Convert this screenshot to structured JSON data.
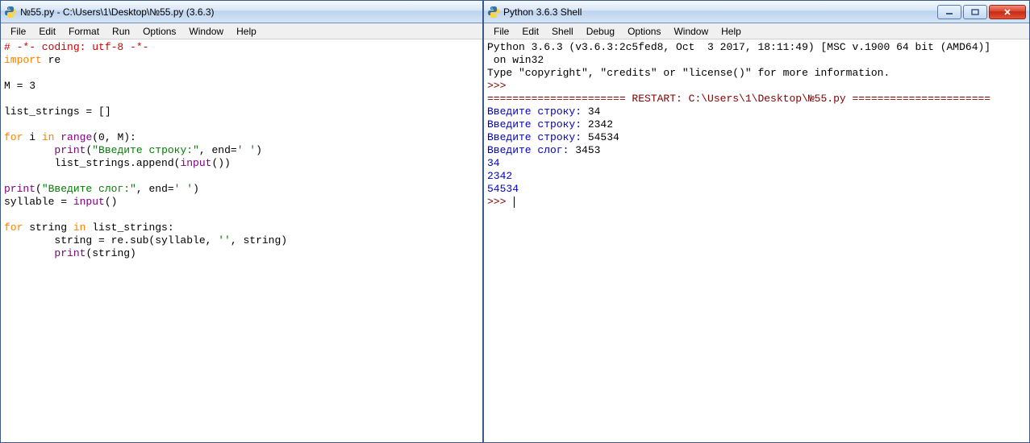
{
  "editor": {
    "title": "№55.py - C:\\Users\\1\\Desktop\\№55.py (3.6.3)",
    "menu": [
      "File",
      "Edit",
      "Format",
      "Run",
      "Options",
      "Window",
      "Help"
    ],
    "code": [
      {
        "cls": "c-comment",
        "text": "# -*- coding: utf-8 -*-"
      },
      [
        {
          "cls": "c-keyword",
          "text": "import"
        },
        {
          "cls": "c-normal",
          "text": " re"
        }
      ],
      "",
      [
        {
          "cls": "c-normal",
          "text": "M = 3"
        }
      ],
      "",
      [
        {
          "cls": "c-normal",
          "text": "list_strings = []"
        }
      ],
      "",
      [
        {
          "cls": "c-keyword",
          "text": "for"
        },
        {
          "cls": "c-normal",
          "text": " i "
        },
        {
          "cls": "c-keyword",
          "text": "in"
        },
        {
          "cls": "c-normal",
          "text": " "
        },
        {
          "cls": "c-builtin",
          "text": "range"
        },
        {
          "cls": "c-normal",
          "text": "(0, M):"
        }
      ],
      [
        {
          "cls": "c-normal",
          "text": "        "
        },
        {
          "cls": "c-builtin",
          "text": "print"
        },
        {
          "cls": "c-normal",
          "text": "("
        },
        {
          "cls": "c-string",
          "text": "\"Введите строку:\""
        },
        {
          "cls": "c-normal",
          "text": ", end="
        },
        {
          "cls": "c-string",
          "text": "' '"
        },
        {
          "cls": "c-normal",
          "text": ")"
        }
      ],
      [
        {
          "cls": "c-normal",
          "text": "        list_strings.append("
        },
        {
          "cls": "c-builtin",
          "text": "input"
        },
        {
          "cls": "c-normal",
          "text": "())"
        }
      ],
      "",
      [
        {
          "cls": "c-builtin",
          "text": "print"
        },
        {
          "cls": "c-normal",
          "text": "("
        },
        {
          "cls": "c-string",
          "text": "\"Введите слог:\""
        },
        {
          "cls": "c-normal",
          "text": ", end="
        },
        {
          "cls": "c-string",
          "text": "' '"
        },
        {
          "cls": "c-normal",
          "text": ")"
        }
      ],
      [
        {
          "cls": "c-normal",
          "text": "syllable = "
        },
        {
          "cls": "c-builtin",
          "text": "input"
        },
        {
          "cls": "c-normal",
          "text": "()"
        }
      ],
      "",
      [
        {
          "cls": "c-keyword",
          "text": "for"
        },
        {
          "cls": "c-normal",
          "text": " string "
        },
        {
          "cls": "c-keyword",
          "text": "in"
        },
        {
          "cls": "c-normal",
          "text": " list_strings:"
        }
      ],
      [
        {
          "cls": "c-normal",
          "text": "        string = re.sub(syllable, "
        },
        {
          "cls": "c-string",
          "text": "''"
        },
        {
          "cls": "c-normal",
          "text": ", string)"
        }
      ],
      [
        {
          "cls": "c-normal",
          "text": "        "
        },
        {
          "cls": "c-builtin",
          "text": "print"
        },
        {
          "cls": "c-normal",
          "text": "(string)"
        }
      ]
    ]
  },
  "shell": {
    "title": "Python 3.6.3 Shell",
    "menu": [
      "File",
      "Edit",
      "Shell",
      "Debug",
      "Options",
      "Window",
      "Help"
    ],
    "lines": [
      [
        {
          "cls": "c-normal",
          "text": "Python 3.6.3 (v3.6.3:2c5fed8, Oct  3 2017, 18:11:49) [MSC v.1900 64 bit (AMD64)]"
        }
      ],
      [
        {
          "cls": "c-normal",
          "text": " on win32"
        }
      ],
      [
        {
          "cls": "c-normal",
          "text": "Type \"copyright\", \"credits\" or \"license()\" for more information."
        }
      ],
      [
        {
          "cls": "c-prompt",
          "text": ">>> "
        }
      ],
      [
        {
          "cls": "c-prompt",
          "text": "====================== RESTART: C:\\Users\\1\\Desktop\\№55.py ======================"
        }
      ],
      [
        {
          "cls": "c-blue",
          "text": "Введите строку:"
        },
        {
          "cls": "c-normal",
          "text": " 34"
        }
      ],
      [
        {
          "cls": "c-blue",
          "text": "Введите строку:"
        },
        {
          "cls": "c-normal",
          "text": " 2342"
        }
      ],
      [
        {
          "cls": "c-blue",
          "text": "Введите строку:"
        },
        {
          "cls": "c-normal",
          "text": " 54534"
        }
      ],
      [
        {
          "cls": "c-blue",
          "text": "Введите слог:"
        },
        {
          "cls": "c-normal",
          "text": " 3453"
        }
      ],
      [
        {
          "cls": "c-blue",
          "text": "34"
        }
      ],
      [
        {
          "cls": "c-blue",
          "text": "2342"
        }
      ],
      [
        {
          "cls": "c-blue",
          "text": "54534"
        }
      ],
      [
        {
          "cls": "c-prompt",
          "text": ">>> "
        },
        {
          "cursor": true
        }
      ]
    ]
  }
}
